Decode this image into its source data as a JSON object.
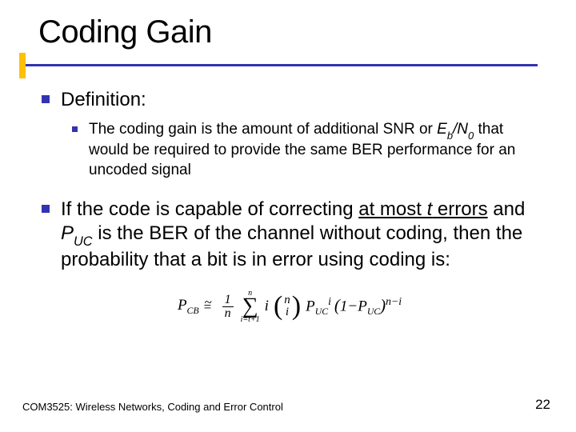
{
  "title": "Coding Gain",
  "definition_label": "Definition:",
  "definition_body": {
    "pre": "The coding gain is the amount of additional SNR or ",
    "eb": "E",
    "eb_sub": "b",
    "slash_n": "/N",
    "n_sub": "0",
    "post": " that would be required to provide the same BER performance for an uncoded signal"
  },
  "paragraph": {
    "p1": "If the code is capable of correcting ",
    "at_most": "at most ",
    "t": "t",
    "errors": " errors",
    "p2": " and ",
    "puc_p": "P",
    "puc_sub": "UC",
    "p3": " is the BER of the channel without coding, then the probability that a bit is in error using coding is:"
  },
  "formula": {
    "lhs_P": "P",
    "lhs_sub": "CB",
    "frac_num": "1",
    "frac_den": "n",
    "sum_top": "n",
    "sum_bot": "i=t+1",
    "i": "i",
    "binom_n": "n",
    "binom_i": "i",
    "P1": "P",
    "P1_sub": "UC",
    "P1_sup": "i",
    "one": "1",
    "minus": "−",
    "P2": "P",
    "P2_sub": "UC",
    "exp2_a": "n",
    "exp2_b": "−",
    "exp2_c": "i"
  },
  "footer": "COM3525: Wireless Networks, Coding and Error Control",
  "page": "22"
}
